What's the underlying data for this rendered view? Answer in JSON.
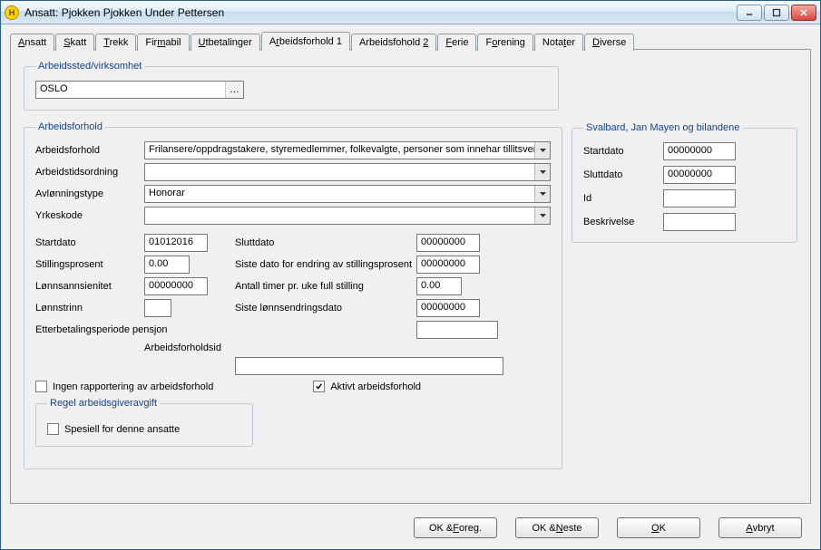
{
  "window": {
    "title": "Ansatt: Pjokken Pjokken Under Pettersen"
  },
  "tabs": [
    {
      "label": "Ansatt",
      "ul": "A",
      "rest": "nsatt"
    },
    {
      "label": "Skatt",
      "ul": "S",
      "rest": "katt"
    },
    {
      "label": "Trekk",
      "ul": "T",
      "rest": "rekk"
    },
    {
      "label": "Firmabil",
      "pre": "Fir",
      "ul": "m",
      "rest": "abil"
    },
    {
      "label": "Utbetalinger",
      "ul": "U",
      "rest": "tbetalinger"
    },
    {
      "label": "Arbeidsforhold 1",
      "pre": "A",
      "ul": "r",
      "rest": "beidsforhold 1"
    },
    {
      "label": "Arbeidsfohold 2",
      "pre": "Arbeidsfohold ",
      "ul": "2",
      "rest": ""
    },
    {
      "label": "Ferie",
      "ul": "F",
      "rest": "erie"
    },
    {
      "label": "Forening",
      "pre": "F",
      "ul": "o",
      "rest": "rening"
    },
    {
      "label": "Notater",
      "pre": "Nota",
      "ul": "t",
      "rest": "er"
    },
    {
      "label": "Diverse",
      "ul": "D",
      "rest": "iverse"
    }
  ],
  "activeTabIndex": 5,
  "workplace": {
    "legend": "Arbeidssted/virksomhet",
    "value": "OSLO"
  },
  "arbeidsforhold": {
    "legend": "Arbeidsforhold",
    "fields": {
      "arbeidsforhold_label": "Arbeidsforhold",
      "arbeidsforhold_value": "Frilansere/oppdragstakere, styremedlemmer, folkevalgte, personer som innehar tillitsverv,",
      "arbeidstidsordning_label": "Arbeidstidsordning",
      "arbeidstidsordning_value": "",
      "avlonningstype_label": "Avlønningstype",
      "avlonningstype_value": "Honorar",
      "yrkeskode_label": "Yrkeskode",
      "yrkeskode_value": ""
    },
    "pairs": {
      "startdato_label": "Startdato",
      "startdato_value": "01012016",
      "sluttdato_label": "Sluttdato",
      "sluttdato_value": "00000000",
      "stillingsprosent_label": "Stillingsprosent",
      "stillingsprosent_value": "0.00",
      "sistedato_label": "Siste dato for endring av stillingsprosent",
      "sistedato_value": "00000000",
      "lonnsans_label": "Lønnsannsienitet",
      "lonnsans_value": "00000000",
      "antalltimer_label": "Antall timer pr. uke full stilling",
      "antalltimer_value": "0.00",
      "lonnstrinn_label": "Lønnstrinn",
      "lonnstrinn_value": "",
      "sistelonn_label": "Siste lønnsendringsdato",
      "sistelonn_value": "00000000",
      "etterbet_label": "Etterbetalingsperiode pensjon",
      "etterbet_value": "",
      "arbfid_label": "Arbeidsforholdsid",
      "arbfid_value": ""
    },
    "checkboxes": {
      "ingen_label": "Ingen rapportering av arbeidsforhold",
      "ingen_checked": false,
      "aktivt_label": "Aktivt arbeidsforhold",
      "aktivt_checked": true
    },
    "regel": {
      "legend": "Regel arbeidsgiveravgift",
      "spesiell_label": "Spesiell for denne ansatte",
      "spesiell_checked": false
    }
  },
  "svalbard": {
    "legend": "Svalbard, Jan Mayen og bilandene",
    "startdato_label": "Startdato",
    "startdato_value": "00000000",
    "sluttdato_label": "Sluttdato",
    "sluttdato_value": "00000000",
    "id_label": "Id",
    "id_value": "",
    "beskrivelse_label": "Beskrivelse",
    "beskrivelse_value": ""
  },
  "buttons": {
    "ok_foreg_pre": "OK & ",
    "ok_foreg_ul": "F",
    "ok_foreg_rest": "oreg.",
    "ok_neste_pre": "OK & ",
    "ok_neste_ul": "N",
    "ok_neste_rest": "este",
    "ok_pre": "",
    "ok_ul": "O",
    "ok_rest": "K",
    "avbryt_pre": "",
    "avbryt_ul": "A",
    "avbryt_rest": "vbryt"
  }
}
